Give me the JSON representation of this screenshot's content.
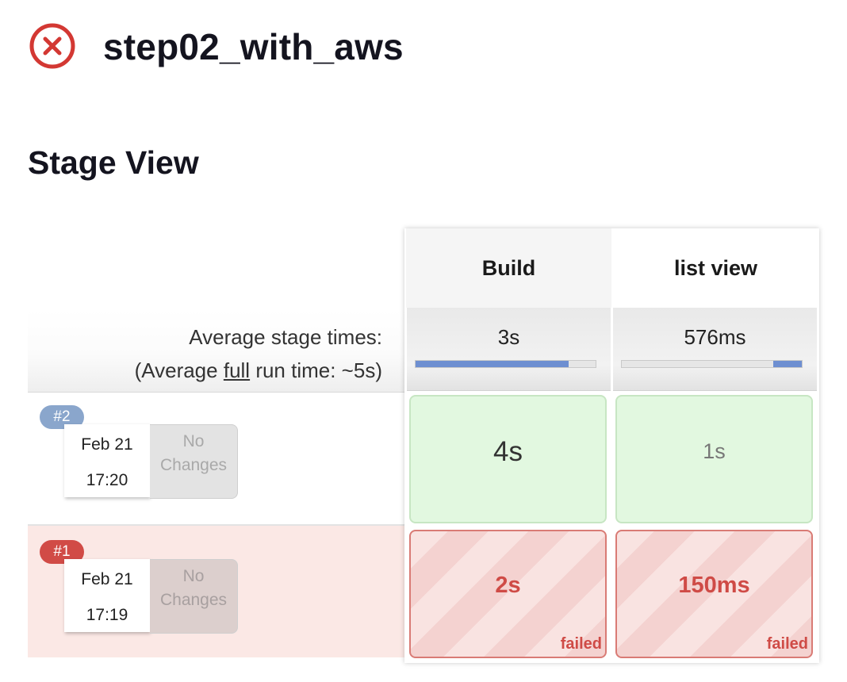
{
  "job": {
    "title": "step02_with_aws",
    "status_icon": "failed-circle-x-icon",
    "status_color": "#d33833"
  },
  "section": {
    "title": "Stage View"
  },
  "averages": {
    "line1": "Average stage times:",
    "line2_prefix": "(Average ",
    "line2_link": "full",
    "line2_suffix": " run time: ~5s)"
  },
  "stages": [
    {
      "name": "Build",
      "avg": "3s",
      "avg_fraction": 0.85
    },
    {
      "name": "list view",
      "avg": "576ms",
      "avg_fraction": 0.16
    }
  ],
  "builds": [
    {
      "badge": "#2",
      "date": "Feb 21",
      "time": "17:20",
      "changes": [
        "No",
        "Changes"
      ],
      "status": "success",
      "cells": [
        {
          "value": "4s",
          "status": "success"
        },
        {
          "value": "1s",
          "status": "success"
        }
      ]
    },
    {
      "badge": "#1",
      "date": "Feb 21",
      "time": "17:19",
      "changes": [
        "No",
        "Changes"
      ],
      "status": "failed",
      "cells": [
        {
          "value": "2s",
          "status": "failed",
          "flag": "failed"
        },
        {
          "value": "150ms",
          "status": "failed",
          "flag": "failed"
        }
      ]
    }
  ],
  "colors": {
    "success_bg": "#e2f8e0",
    "failed_text": "#cf4b46",
    "progress_fill": "#6e8fd1",
    "badge_success": "#8aa6cc",
    "badge_failed": "#d14b46"
  }
}
